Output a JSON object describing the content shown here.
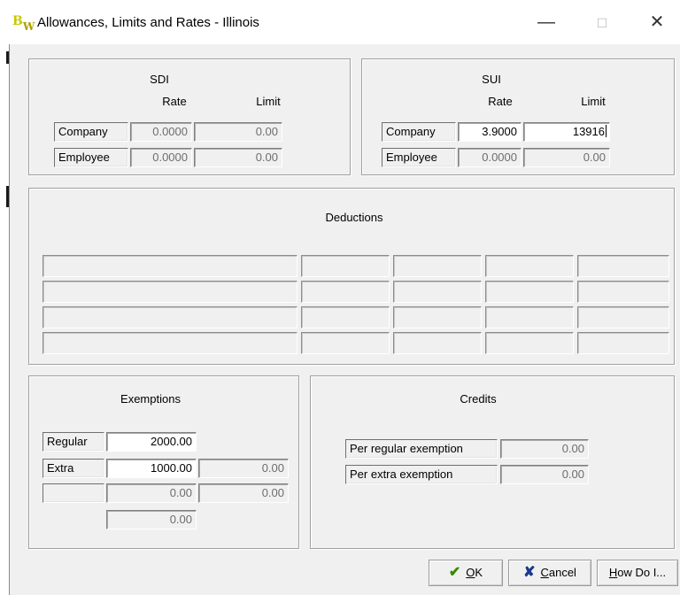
{
  "window": {
    "title": "Allowances, Limits and Rates - Illinois",
    "app_icon_text": "B",
    "app_icon_sub": "W",
    "minimize": "—",
    "maximize": "☐",
    "close": "✕"
  },
  "sdi": {
    "title": "SDI",
    "rate_header": "Rate",
    "limit_header": "Limit",
    "rows": [
      {
        "label": "Company",
        "rate": "0.0000",
        "limit": "0.00"
      },
      {
        "label": "Employee",
        "rate": "0.0000",
        "limit": "0.00"
      }
    ]
  },
  "sui": {
    "title": "SUI",
    "rate_header": "Rate",
    "limit_header": "Limit",
    "rows": [
      {
        "label": "Company",
        "rate": "3.9000",
        "limit": "13916"
      },
      {
        "label": "Employee",
        "rate": "0.0000",
        "limit": "0.00"
      }
    ]
  },
  "deductions": {
    "title": "Deductions"
  },
  "exemptions": {
    "title": "Exemptions",
    "regular_label": "Regular",
    "regular_value": "2000.00",
    "extra_label": "Extra",
    "extra_value": "1000.00",
    "extra_value2": "0.00",
    "row3_value": "0.00",
    "row3_value2": "0.00",
    "row4_value": "0.00"
  },
  "credits": {
    "title": "Credits",
    "per_regular_label": "Per regular exemption",
    "per_regular_value": "0.00",
    "per_extra_label": "Per extra exemption",
    "per_extra_value": "0.00"
  },
  "buttons": {
    "ok_icon": "✔",
    "ok_mnemonic": "O",
    "ok_rest": "K",
    "cancel_icon": "✘",
    "cancel_mnemonic": "C",
    "cancel_rest": "ancel",
    "howdo_mnemonic": "H",
    "howdo_rest": "ow Do I..."
  },
  "colors": {
    "ok_icon": "#3a8a00",
    "cancel_icon": "#1a3a8c",
    "dialog_bg": "#f0f0f0"
  }
}
